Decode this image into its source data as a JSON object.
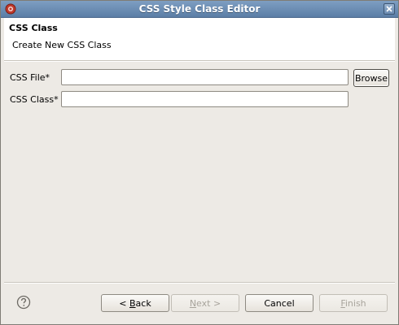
{
  "window": {
    "title": "CSS Style Class Editor"
  },
  "banner": {
    "title": "CSS Class",
    "description": "Create New CSS Class"
  },
  "form": {
    "css_file_label": "CSS File*",
    "css_file_value": "",
    "browse_label": "Browse",
    "css_class_label": "CSS Class*",
    "css_class_value": ""
  },
  "footer": {
    "back_label": "< Back",
    "back_mnemonic": "B",
    "next_label": "Next >",
    "next_mnemonic": "N",
    "cancel_label": "Cancel",
    "finish_label": "Finish",
    "finish_mnemonic": "F"
  },
  "icons": {
    "app": "app-icon",
    "close": "close-icon",
    "help": "help-icon"
  },
  "colors": {
    "titlebar": "#5b7ea6",
    "background": "#edeae5",
    "disabled_text": "#a8a49c"
  }
}
